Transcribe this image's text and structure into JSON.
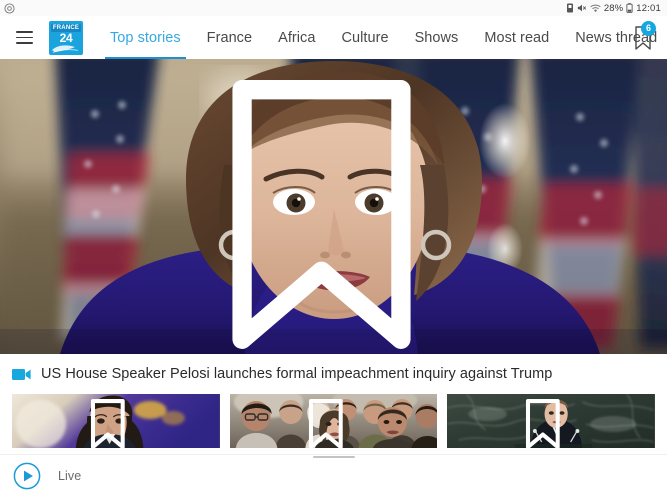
{
  "status_bar": {
    "left_icon": "camera-circle-icon",
    "icons": [
      "sim-card-icon",
      "mute-icon",
      "wifi-icon"
    ],
    "battery_percent": "28%",
    "battery_icon": "battery-icon",
    "time": "12:01"
  },
  "appbar": {
    "menu_icon": "hamburger-menu-icon",
    "logo": {
      "top_text": "FRANCE",
      "bottom_text": "24",
      "color": "#1ba3dd"
    },
    "tabs": [
      {
        "label": "Top stories",
        "active": true
      },
      {
        "label": "France",
        "active": false
      },
      {
        "label": "Africa",
        "active": false
      },
      {
        "label": "Culture",
        "active": false
      },
      {
        "label": "Shows",
        "active": false
      },
      {
        "label": "Most read",
        "active": false
      },
      {
        "label": "News thread",
        "active": false
      }
    ],
    "bookmark": {
      "icon": "bookmark-icon",
      "badge_count": "6",
      "badge_color": "#17a7e0"
    },
    "active_tab_color": "#36a9e1",
    "indicator_color": "#1f8fd0"
  },
  "hero": {
    "alt": "Nancy Pelosi speaking in front of US flags",
    "bookmark_icon": "bookmark-outline-icon"
  },
  "headline": {
    "video_icon": "video-camera-icon",
    "video_icon_color": "#19a8dd",
    "text": "US House Speaker Pelosi launches formal impeachment inquiry against Trump"
  },
  "cards": [
    {
      "alt": "Man in front of blue purple backdrop",
      "bookmark_icon": "bookmark-outline-icon"
    },
    {
      "alt": "Crowd of people at an event",
      "bookmark_icon": "bookmark-outline-icon"
    },
    {
      "alt": "Emmanuel Macron speaking at UN podium",
      "bookmark_icon": "bookmark-outline-icon"
    }
  ],
  "scroll_indicator": {
    "name": "carousel-scroll-indicator"
  },
  "bottom_bar": {
    "play_icon": "play-circle-icon",
    "play_color": "#1b9ad8",
    "live_label": "Live"
  }
}
